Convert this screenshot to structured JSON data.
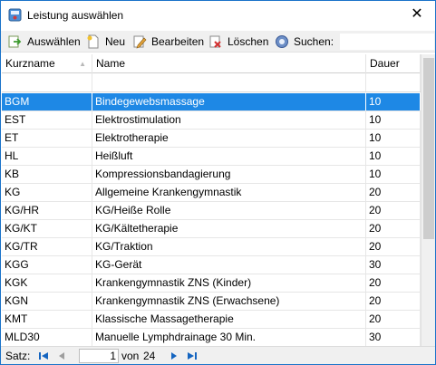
{
  "window": {
    "title": "Leistung auswählen",
    "close_glyph": "✕"
  },
  "toolbar": {
    "select_label": "Auswählen",
    "new_label": "Neu",
    "edit_label": "Bearbeiten",
    "delete_label": "Löschen",
    "search_label": "Suchen:",
    "search_value": ""
  },
  "grid": {
    "columns": [
      "Kurzname",
      "Name",
      "Dauer"
    ],
    "selected_index": 0,
    "rows": [
      {
        "kurz": "BGM",
        "name": "Bindegewebsmassage",
        "dauer": "10"
      },
      {
        "kurz": "EST",
        "name": "Elektrostimulation",
        "dauer": "10"
      },
      {
        "kurz": "ET",
        "name": "Elektrotherapie",
        "dauer": "10"
      },
      {
        "kurz": "HL",
        "name": "Heißluft",
        "dauer": "10"
      },
      {
        "kurz": "KB",
        "name": "Kompressionsbandagierung",
        "dauer": "10"
      },
      {
        "kurz": "KG",
        "name": "Allgemeine Krankengymnastik",
        "dauer": "20"
      },
      {
        "kurz": "KG/HR",
        "name": "KG/Heiße Rolle",
        "dauer": "20"
      },
      {
        "kurz": "KG/KT",
        "name": "KG/Kältetherapie",
        "dauer": "20"
      },
      {
        "kurz": "KG/TR",
        "name": "KG/Traktion",
        "dauer": "20"
      },
      {
        "kurz": "KGG",
        "name": "KG-Gerät",
        "dauer": "30"
      },
      {
        "kurz": "KGK",
        "name": "Krankengymnastik ZNS (Kinder)",
        "dauer": "20"
      },
      {
        "kurz": "KGN",
        "name": "Krankengymnastik ZNS (Erwachsene)",
        "dauer": "20"
      },
      {
        "kurz": "KMT",
        "name": "Klassische Massagetherapie",
        "dauer": "20"
      },
      {
        "kurz": "MLD30",
        "name": "Manuelle Lymphdrainage 30 Min.",
        "dauer": "30"
      }
    ]
  },
  "status": {
    "label": "Satz:",
    "current_record": "1",
    "of_label": "von",
    "total_records": "24"
  },
  "colors": {
    "selection": "#1e88e5",
    "window_border": "#1a73c9"
  }
}
